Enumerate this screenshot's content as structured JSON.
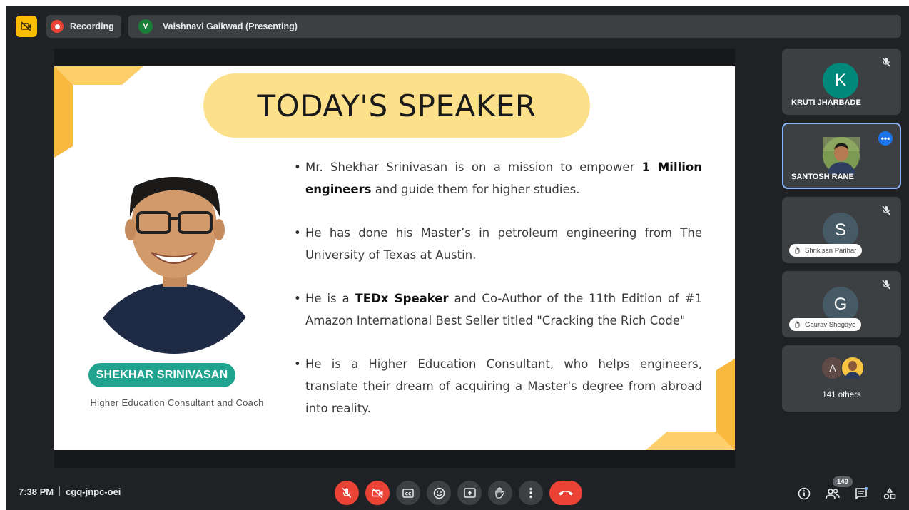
{
  "topbar": {
    "recording_label": "Recording",
    "presenter_initial": "V",
    "presenter_label": "Vaishnavi Gaikwad (Presenting)"
  },
  "slide": {
    "title": "TODAY'S SPEAKER",
    "speaker_name": "SHEKHAR SRINIVASAN",
    "speaker_role": "Higher Education Consultant and Coach",
    "bullets": [
      {
        "pre": "Mr. Shekhar Srinivasan is on a mission to empower ",
        "bold": "1 Million engineers",
        "post": " and guide them for higher studies."
      },
      {
        "pre": "He has done his Master’s in petroleum engineering from The University of Texas at Austin.",
        "bold": "",
        "post": ""
      },
      {
        "pre": "He is a ",
        "bold": "TEDx Speaker",
        "post": " and Co-Author of the 11th Edition of #1 Amazon International Best Seller titled \"Cracking the Rich Code\""
      },
      {
        "pre": "He is a Higher Education Consultant, who helps engineers, translate their dream of acquiring a Master's degree from abroad into reality.",
        "bold": "",
        "post": ""
      }
    ]
  },
  "participants": [
    {
      "initial": "K",
      "name": "KRUTI JHARBADE",
      "avatar_color": "#00897b",
      "muted": true
    },
    {
      "initial": "",
      "name": "SANTOSH RANE",
      "avatar_color": "#6d8a4e",
      "muted": false
    },
    {
      "initial": "S",
      "name": "Shrikisan Parihar",
      "avatar_color": "#455a64",
      "muted": true
    },
    {
      "initial": "G",
      "name": "Gaurav Shegaye",
      "avatar_color": "#455a64",
      "muted": true
    }
  ],
  "others": {
    "initial": "A",
    "label": "141 others"
  },
  "bottombar": {
    "time": "7:38 PM",
    "meeting_code": "cgq-jnpc-oei",
    "people_count": "149"
  },
  "colors": {
    "background": "#202124",
    "control": "#3c4043",
    "danger": "#ea4335",
    "accent_yellow": "#fbbc04",
    "title_pill": "#fde08a",
    "name_pill": "#20a38f"
  }
}
